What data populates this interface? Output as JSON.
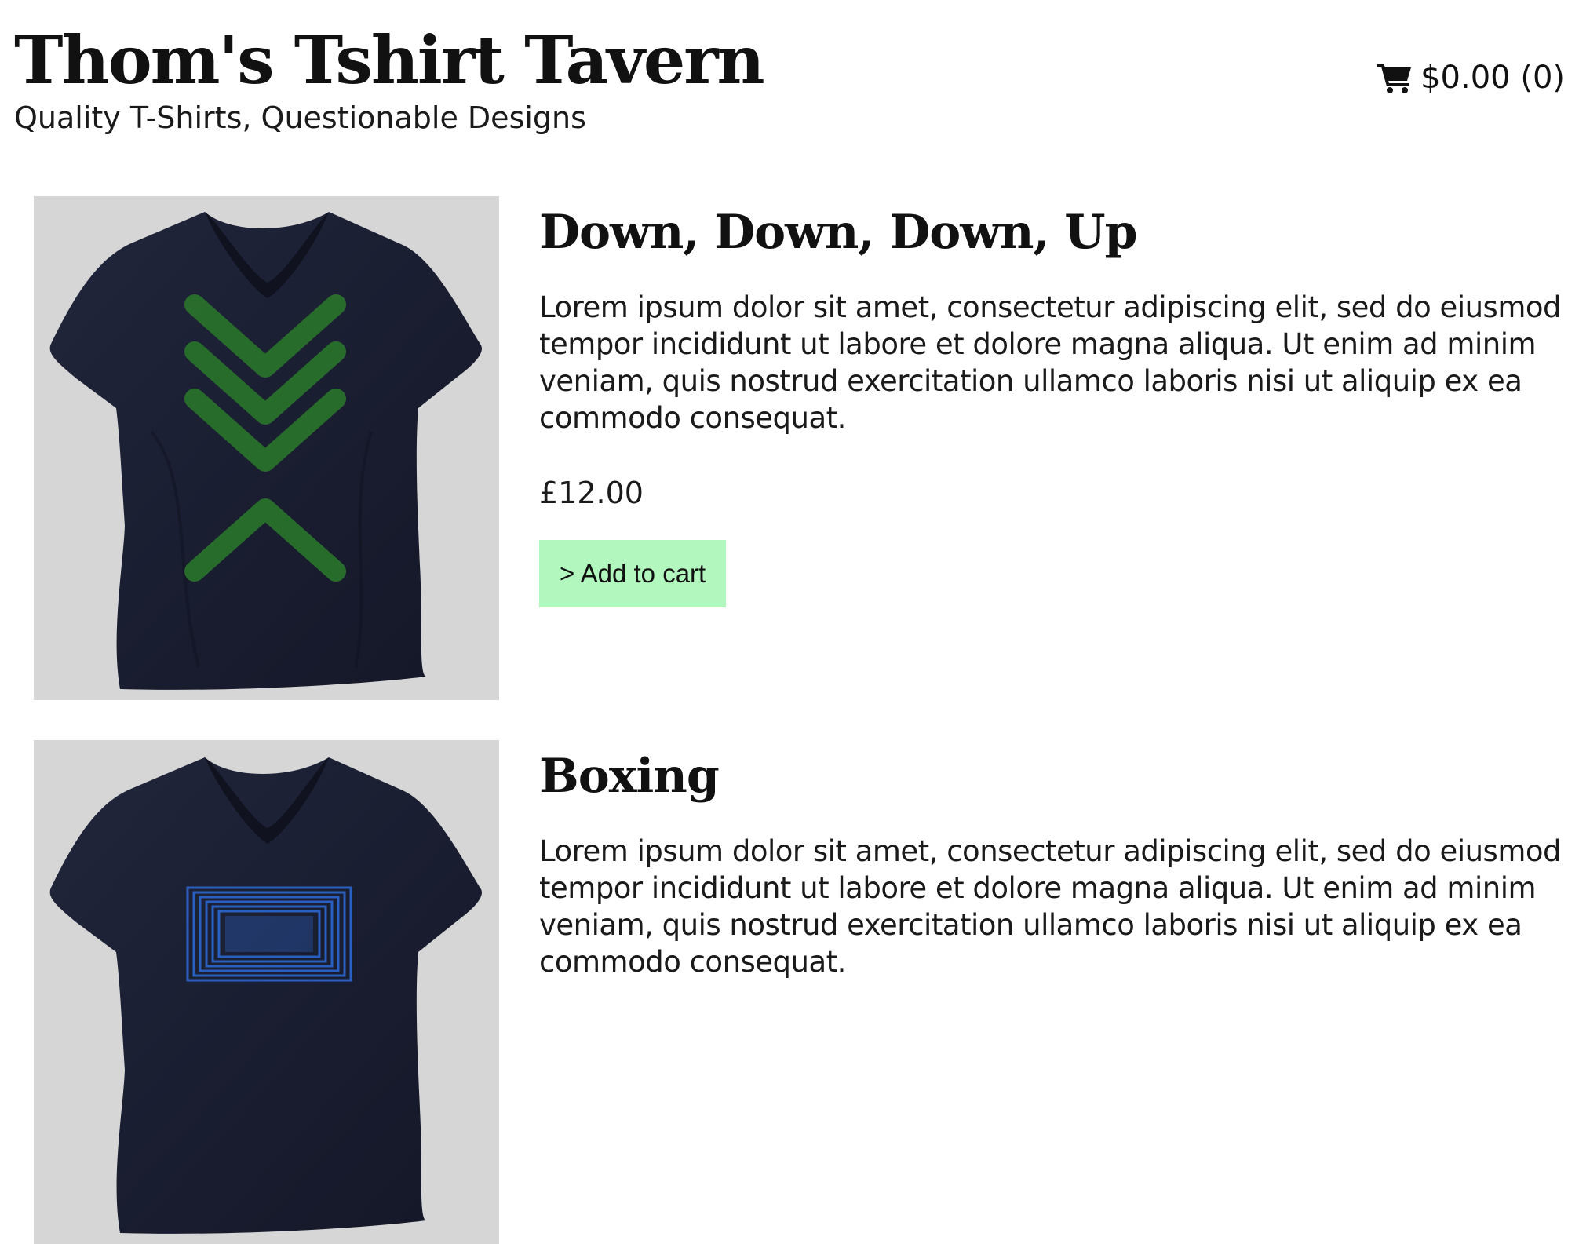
{
  "site": {
    "title": "Thom's Tshirt Tavern",
    "tagline": "Quality T-Shirts, Questionable Designs"
  },
  "cart": {
    "icon": "shopping-cart-icon",
    "summary": "$0.00 (0)"
  },
  "products": [
    {
      "name": "Down, Down, Down, Up",
      "description": "Lorem ipsum dolor sit amet, consectetur adipiscing elit, sed do eiusmod tempor incididunt ut labore et dolore magna aliqua. Ut enim ad minim veniam, quis nostrud exercitation ullamco laboris nisi ut aliquip ex ea commodo consequat.",
      "price": "£12.00",
      "button_label": "> Add to cart",
      "image": {
        "icon": "tshirt-chevrons-image",
        "design": "three down chevrons and one up chevron",
        "design_color": "#2b7a2b"
      }
    },
    {
      "name": "Boxing",
      "description": "Lorem ipsum dolor sit amet, consectetur adipiscing elit, sed do eiusmod tempor incididunt ut labore et dolore magna aliqua. Ut enim ad minim veniam, quis nostrud exercitation ullamco laboris nisi ut aliquip ex ea commodo consequat.",
      "image": {
        "icon": "tshirt-boxes-image",
        "design": "nested rectangles",
        "design_color": "#2a63c9"
      }
    }
  ],
  "colors": {
    "button_bg": "#b1f7be",
    "image_bg": "#d6d6d6",
    "shirt": "#1b1f33"
  }
}
